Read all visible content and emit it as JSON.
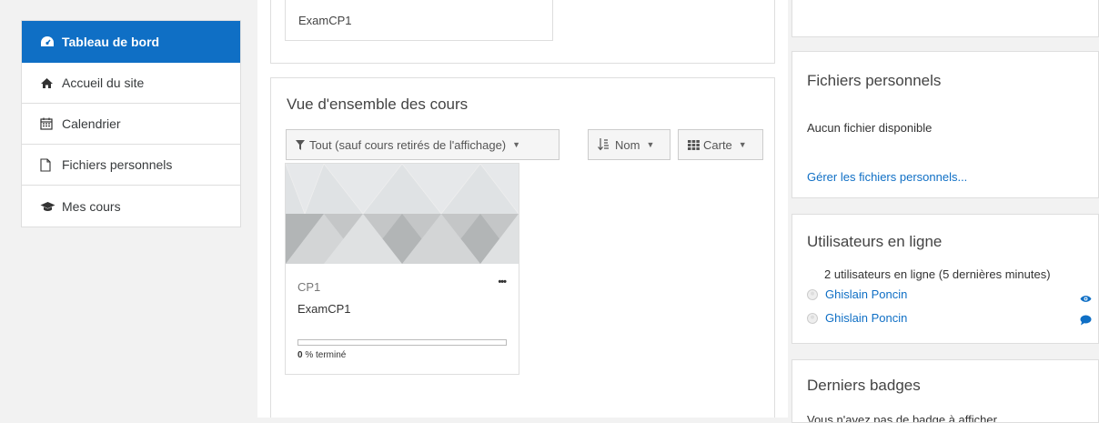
{
  "nav": {
    "items": [
      {
        "label": "Tableau de bord",
        "icon": "dashboard-icon"
      },
      {
        "label": "Accueil du site",
        "icon": "home-icon"
      },
      {
        "label": "Calendrier",
        "icon": "calendar-icon"
      },
      {
        "label": "Fichiers personnels",
        "icon": "file-icon"
      },
      {
        "label": "Mes cours",
        "icon": "graduation-cap-icon"
      }
    ]
  },
  "top_card": {
    "course_name": "ExamCP1"
  },
  "overview": {
    "title": "Vue d'ensemble des cours",
    "filter_label": "Tout (sauf cours retirés de l'affichage)",
    "sort_label": "Nom",
    "view_label": "Carte",
    "course": {
      "short_name": "CP1",
      "full_name": "ExamCP1",
      "menu_label": "•••",
      "progress_value": "0",
      "progress_suffix": " % terminé",
      "progress_fraction": 0
    }
  },
  "private_files": {
    "title": "Fichiers personnels",
    "empty_text": "Aucun fichier disponible",
    "manage_link": "Gérer les fichiers personnels..."
  },
  "online_users": {
    "title": "Utilisateurs en ligne",
    "summary": "2 utilisateurs en ligne (5 dernières minutes)",
    "users": [
      {
        "name": "Ghislain Poncin",
        "action_icon": "eye-icon"
      },
      {
        "name": "Ghislain Poncin",
        "action_icon": "message-icon"
      }
    ]
  },
  "badges": {
    "title": "Derniers badges",
    "text": "Vous n'avez pas de badge à afficher"
  },
  "colors": {
    "accent": "#0f6fc5",
    "border": "#dedede"
  }
}
